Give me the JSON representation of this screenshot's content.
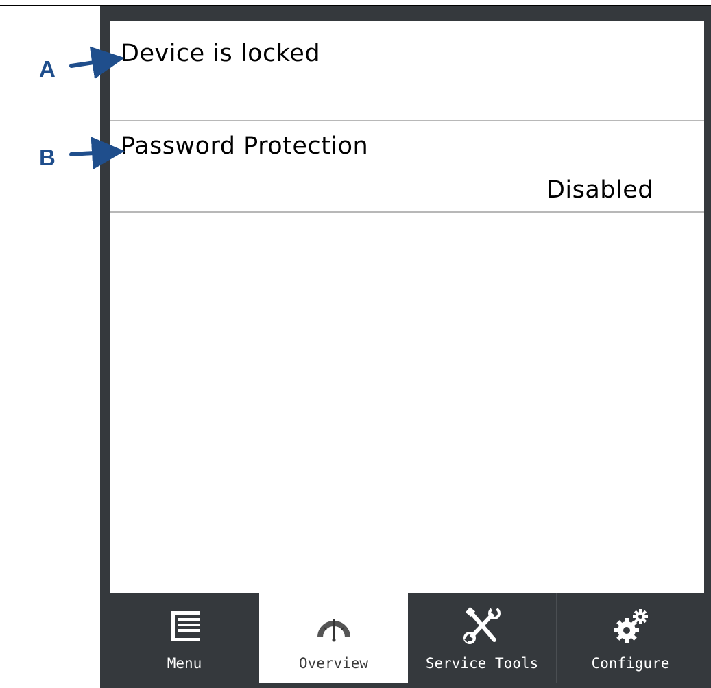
{
  "screen": {
    "locked_row": {
      "title": "Device is locked"
    },
    "password_row": {
      "title": "Password Protection",
      "value": "Disabled"
    }
  },
  "nav": {
    "tabs": [
      {
        "label": "Menu",
        "icon": "menu-list-icon",
        "active": false
      },
      {
        "label": "Overview",
        "icon": "gauge-icon",
        "active": true
      },
      {
        "label": "Service Tools",
        "icon": "wrench-screwdriver-icon",
        "active": false
      },
      {
        "label": "Configure",
        "icon": "gears-icon",
        "active": false
      }
    ]
  },
  "annotations": {
    "a": "A",
    "b": "B"
  },
  "colors": {
    "frame": "#35393d",
    "callout": "#1f4e8c",
    "divider": "#b8b8b8"
  }
}
